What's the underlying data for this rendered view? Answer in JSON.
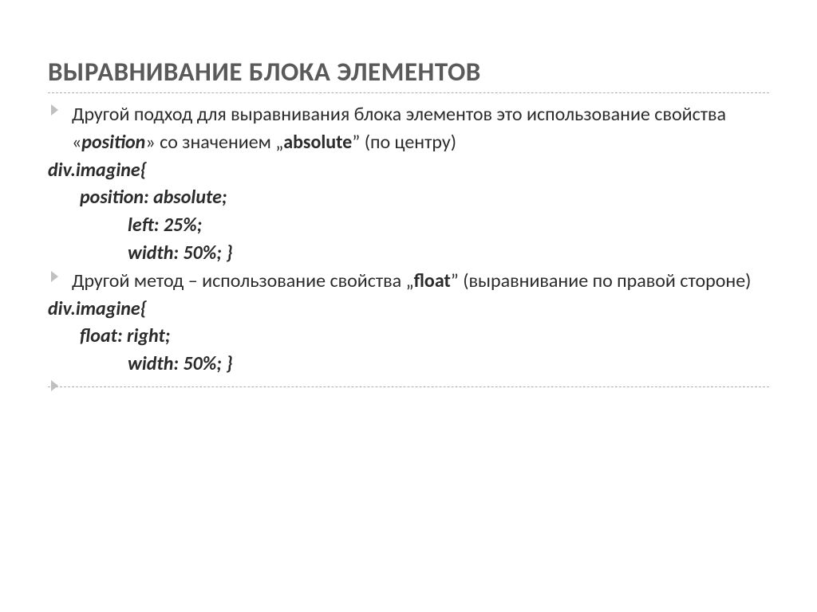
{
  "title": "ВЫРАВНИВАНИЕ БЛОКА ЭЛЕМЕНТОВ",
  "para1": {
    "pre": "Другой подход для выравнивания блока элементов это использование свойства «",
    "prop": "position",
    "mid": "» со значением „",
    "val": "absolute",
    "post": "” (по центру)"
  },
  "code1": {
    "l1": "div.imagine{",
    "l2": "position: absolute;",
    "l3": "left: 25%;",
    "l4": "width: 50%;   }"
  },
  "para2": {
    "pre": "Другой метод – использование свойства „",
    "prop": "float",
    "post": "” (выравнивание по правой стороне)"
  },
  "code2": {
    "l1": "div.imagine{",
    "l2": "float: right;",
    "l3": "width: 50%;   }"
  }
}
